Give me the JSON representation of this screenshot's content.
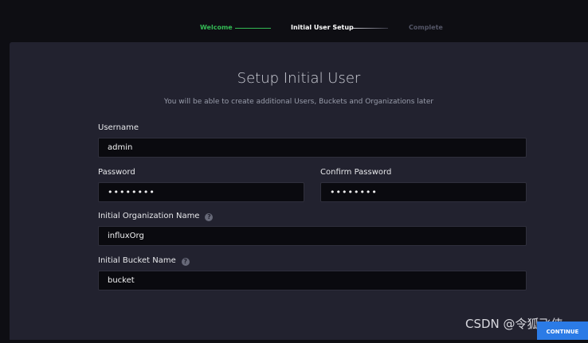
{
  "stepper": {
    "steps": [
      {
        "label": "Welcome",
        "state": "done"
      },
      {
        "label": "Initial User Setup",
        "state": "active"
      },
      {
        "label": "Complete",
        "state": "pending"
      }
    ],
    "colors": {
      "done": "#34bb55",
      "active": "#ffffff",
      "pending": "#545667"
    }
  },
  "form": {
    "title": "Setup Initial User",
    "subtitle": "You will be able to create additional Users, Buckets and Organizations later",
    "username": {
      "label": "Username",
      "value": "admin"
    },
    "password": {
      "label": "Password",
      "value": "••••••••"
    },
    "confirm_password": {
      "label": "Confirm Password",
      "value": "••••••••"
    },
    "organization": {
      "label": "Initial Organization Name",
      "value": "influxOrg",
      "help_icon": "?"
    },
    "bucket": {
      "label": "Initial Bucket Name",
      "value": "bucket",
      "help_icon": "?"
    },
    "continue_label": "CONTINUE"
  },
  "watermark": "CSDN @令狐飞侠"
}
